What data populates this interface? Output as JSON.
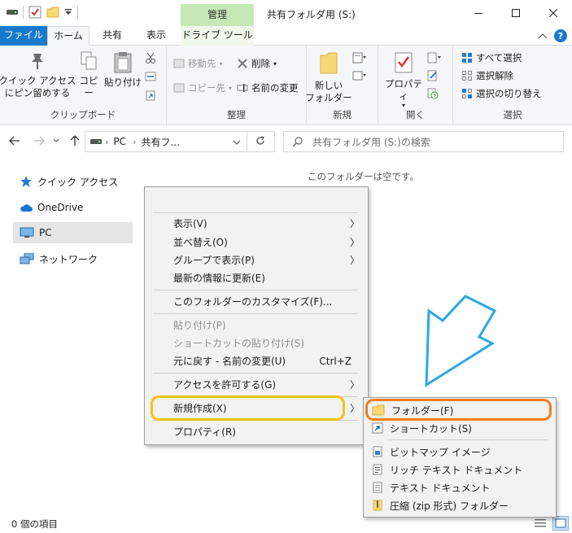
{
  "titlebar": {
    "context_tab": "管理",
    "title": "共有フォルダ用 (S:)"
  },
  "tabs": [
    {
      "label": "ファイル"
    },
    {
      "label": "ホーム"
    },
    {
      "label": "共有"
    },
    {
      "label": "表示"
    },
    {
      "label": "ドライブ ツール"
    }
  ],
  "ribbon": {
    "clipboard": {
      "pin": "クイック アクセス\nにピン留めする",
      "copy": "コピー",
      "paste": "貼り付け",
      "label": "クリップボード"
    },
    "organize": {
      "move_to": "移動先",
      "copy_to": "コピー先",
      "delete": "削除",
      "rename": "名前の変更",
      "label": "整理"
    },
    "new": {
      "new_folder": "新しい\nフォルダー",
      "label": "新規"
    },
    "open": {
      "properties": "プロパティ",
      "label": "開く"
    },
    "select": {
      "select_all": "すべて選択",
      "select_none": "選択解除",
      "invert": "選択の切り替え",
      "label": "選択"
    }
  },
  "address": {
    "crumb1": "PC",
    "crumb2": "共有フ...",
    "search_placeholder": "共有フォルダ用 (S:)の検索"
  },
  "nav": [
    {
      "label": "クイック アクセス",
      "icon": "star-icon"
    },
    {
      "label": "OneDrive",
      "icon": "cloud-icon"
    },
    {
      "label": "PC",
      "icon": "monitor-icon"
    },
    {
      "label": "ネットワーク",
      "icon": "network-icon"
    }
  ],
  "content": {
    "empty_message": "このフォルダーは空です。"
  },
  "status": {
    "items": "0 個の項目"
  },
  "context_menu": {
    "view": "表示(V)",
    "sort": "並べ替え(O)",
    "group": "グループで表示(P)",
    "refresh": "最新の情報に更新(E)",
    "customize": "このフォルダーのカスタマイズ(F)...",
    "paste": "貼り付け(P)",
    "paste_shortcut": "ショートカットの貼り付け(S)",
    "undo": "元に戻す - 名前の変更(U)",
    "undo_shortcut": "Ctrl+Z",
    "access": "アクセスを許可する(G)",
    "new": "新規作成(X)",
    "properties": "プロパティ(R)"
  },
  "submenu": {
    "folder": "フォルダー(F)",
    "shortcut": "ショートカット(S)",
    "bitmap": "ビットマップ イメージ",
    "rtf": "リッチ テキスト ドキュメント",
    "text": "テキスト ドキュメント",
    "zip": "圧縮 (zip 形式) フォルダー"
  },
  "colors": {
    "accent": "#1979ca",
    "context_tab": "#c5e8b4",
    "highlight_yellow": "#f5c518",
    "highlight_orange": "#ef7d22",
    "arrow": "#29aae1"
  }
}
